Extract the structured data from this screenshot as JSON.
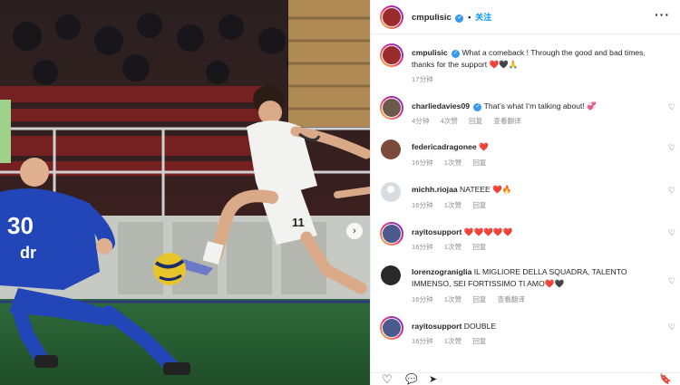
{
  "post": {
    "photo_description_icon": "post-photo",
    "next_arrow": "›",
    "header": {
      "username": "cmpulisic",
      "verified_mark": "✓",
      "dot": "•",
      "follow_label": "关注",
      "more_label": "···"
    },
    "caption": {
      "username": "cmpulisic",
      "text": "What a comeback ! Through the good and bad times, thanks for the support ❤️🖤🙏",
      "time": "17分钟"
    }
  },
  "comments": [
    {
      "username": "charliedavies09",
      "verified": true,
      "text": "That’s what I’m talking about! 💞",
      "time": "4分钟",
      "likes": "4次赞",
      "reply": "回复",
      "translate": "查看翻译"
    },
    {
      "username": "federicadragonee",
      "verified": false,
      "text": "❤️",
      "time": "16分钟",
      "likes": "1次赞",
      "reply": "回复",
      "translate": ""
    },
    {
      "username": "michh.riojaa",
      "verified": false,
      "text": "NATEEE ❤️🔥",
      "time": "16分钟",
      "likes": "1次赞",
      "reply": "回复",
      "translate": ""
    },
    {
      "username": "rayitosupport",
      "verified": false,
      "text": "❤️❤️❤️❤️❤️",
      "time": "16分钟",
      "likes": "1次赞",
      "reply": "回复",
      "translate": ""
    },
    {
      "username": "lorenzograniglia",
      "verified": false,
      "text": "IL MIGLIORE DELLA SQUADRA, TALENTO IMMENSO, SEI FORTISSIMO TI AMO❤️🖤",
      "time": "16分钟",
      "likes": "1次赞",
      "reply": "回复",
      "translate": "查看翻译"
    },
    {
      "username": "rayitosupport",
      "verified": false,
      "text": "DOUBLE",
      "time": "16分钟",
      "likes": "1次赞",
      "reply": "回复",
      "translate": ""
    }
  ],
  "icons": {
    "heart": "♡",
    "comment": "💬",
    "share": "➤",
    "save": "🔖"
  },
  "colors": {
    "accent": "#0095f6",
    "verified": "#3897f0",
    "heart_red": "#ed4956",
    "meta_gray": "#8e8e8e"
  }
}
